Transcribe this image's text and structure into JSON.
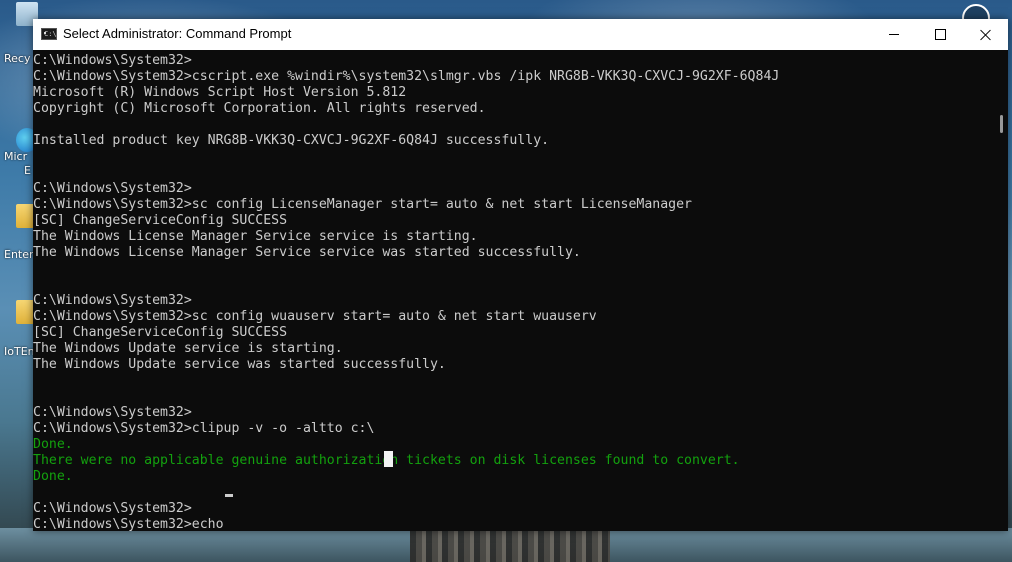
{
  "window": {
    "title": "Select Administrator: Command Prompt",
    "app_icon_text": "C:\\"
  },
  "desktop": {
    "icons": [
      {
        "label": "Recy"
      },
      {
        "label": "Micr"
      },
      {
        "label": "E"
      },
      {
        "label": "Enter"
      },
      {
        "label": "IoTEn"
      }
    ]
  },
  "console": {
    "lines": [
      {
        "text": "C:\\Windows\\System32>",
        "color": "#cccccc"
      },
      {
        "text": "C:\\Windows\\System32>cscript.exe %windir%\\system32\\slmgr.vbs /ipk NRG8B-VKK3Q-CXVCJ-9G2XF-6Q84J",
        "color": "#cccccc"
      },
      {
        "text": "Microsoft (R) Windows Script Host Version 5.812",
        "color": "#cccccc"
      },
      {
        "text": "Copyright (C) Microsoft Corporation. All rights reserved.",
        "color": "#cccccc"
      },
      {
        "text": "",
        "color": "#cccccc"
      },
      {
        "text": "Installed product key NRG8B-VKK3Q-CXVCJ-9G2XF-6Q84J successfully.",
        "color": "#cccccc"
      },
      {
        "text": "",
        "color": "#cccccc"
      },
      {
        "text": "",
        "color": "#cccccc"
      },
      {
        "text": "C:\\Windows\\System32>",
        "color": "#cccccc"
      },
      {
        "text": "C:\\Windows\\System32>sc config LicenseManager start= auto & net start LicenseManager",
        "color": "#cccccc"
      },
      {
        "text": "[SC] ChangeServiceConfig SUCCESS",
        "color": "#cccccc"
      },
      {
        "text": "The Windows License Manager Service service is starting.",
        "color": "#cccccc"
      },
      {
        "text": "The Windows License Manager Service service was started successfully.",
        "color": "#cccccc"
      },
      {
        "text": "",
        "color": "#cccccc"
      },
      {
        "text": "",
        "color": "#cccccc"
      },
      {
        "text": "C:\\Windows\\System32>",
        "color": "#cccccc"
      },
      {
        "text": "C:\\Windows\\System32>sc config wuauserv start= auto & net start wuauserv",
        "color": "#cccccc"
      },
      {
        "text": "[SC] ChangeServiceConfig SUCCESS",
        "color": "#cccccc"
      },
      {
        "text": "The Windows Update service is starting.",
        "color": "#cccccc"
      },
      {
        "text": "The Windows Update service was started successfully.",
        "color": "#cccccc"
      },
      {
        "text": "",
        "color": "#cccccc"
      },
      {
        "text": "",
        "color": "#cccccc"
      },
      {
        "text": "C:\\Windows\\System32>",
        "color": "#cccccc"
      },
      {
        "text": "C:\\Windows\\System32>clipup -v -o -altto c:\\",
        "color": "#cccccc"
      },
      {
        "text": "Done.",
        "color": "#13a10e"
      },
      {
        "text": "There were no applicable genuine authorization tickets on disk licenses found to convert.",
        "color": "#13a10e"
      },
      {
        "text": "Done.",
        "color": "#13a10e"
      },
      {
        "text": "",
        "color": "#cccccc"
      },
      {
        "text": "C:\\Windows\\System32>",
        "color": "#cccccc"
      },
      {
        "text": "C:\\Windows\\System32>echo",
        "color": "#cccccc"
      }
    ]
  },
  "colors": {
    "console_bg": "#0c0c0c",
    "console_fg": "#cccccc",
    "success_green": "#13a10e",
    "titlebar_bg": "#ffffff"
  },
  "icons": {
    "app": "command-prompt-icon",
    "minimize": "minimize-icon",
    "maximize": "maximize-icon",
    "close": "close-icon"
  }
}
